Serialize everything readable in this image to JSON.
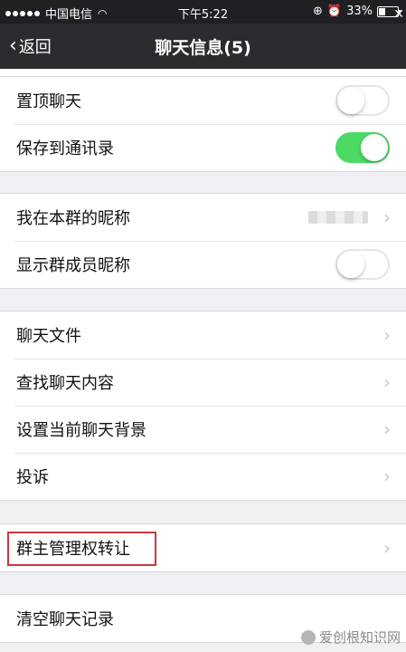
{
  "status_bar": {
    "carrier": "中国电信",
    "time": "下午5:22",
    "battery": "33%",
    "battery_level": 0.33
  },
  "nav": {
    "back_label": "返回",
    "title": "聊天信息(5)"
  },
  "group1": [
    {
      "label": "置顶聊天",
      "toggle": false
    },
    {
      "label": "保存到通讯录",
      "toggle": true
    }
  ],
  "group2": [
    {
      "label": "我在本群的昵称"
    },
    {
      "label": "显示群成员昵称",
      "toggle": false
    }
  ],
  "group3": [
    {
      "label": "聊天文件"
    },
    {
      "label": "查找聊天内容"
    },
    {
      "label": "设置当前聊天背景"
    },
    {
      "label": "投诉"
    }
  ],
  "group4": [
    {
      "label": "群主管理权转让"
    }
  ],
  "group5": [
    {
      "label": "清空聊天记录"
    }
  ],
  "colors": {
    "toggle_on": "#4cd964",
    "highlight": "#d0363b"
  },
  "watermark": "爱创根知识网"
}
